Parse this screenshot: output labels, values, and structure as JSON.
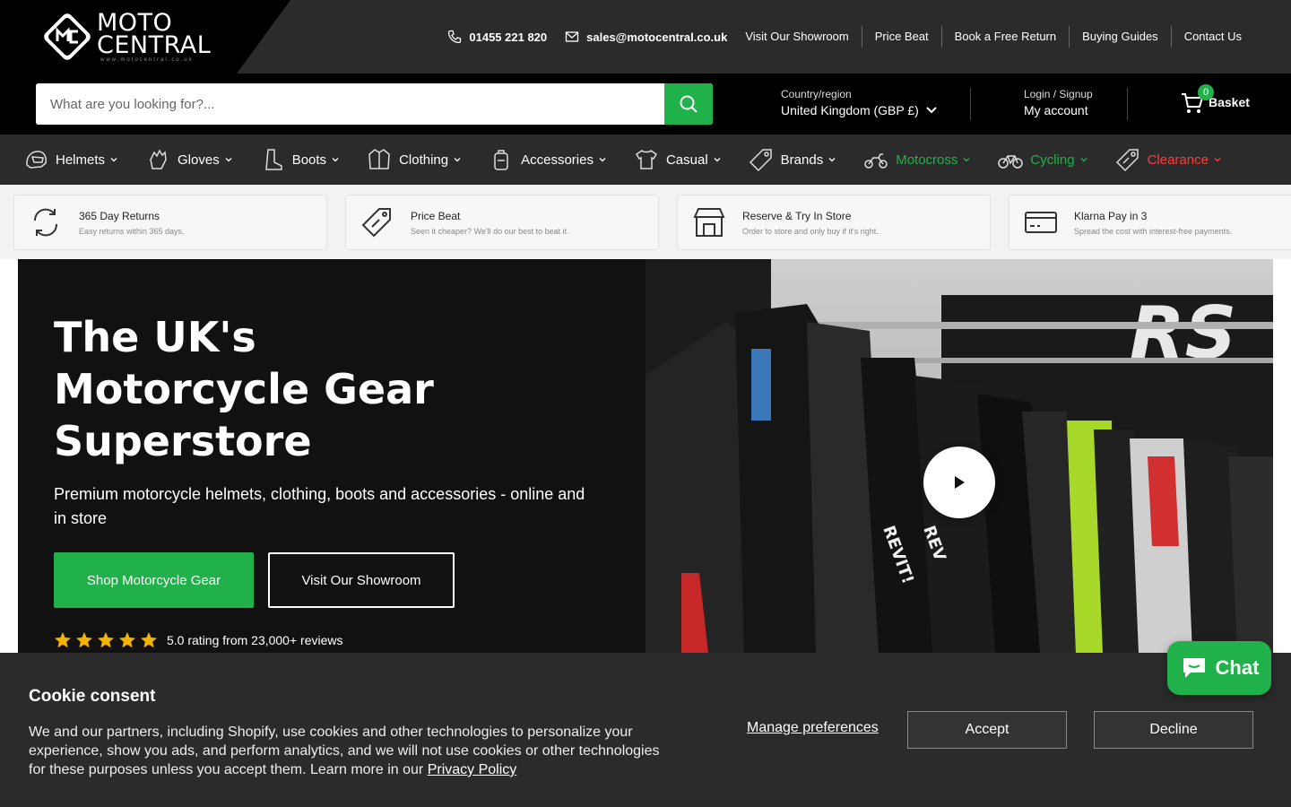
{
  "brand": {
    "name_line1": "MOTO",
    "name_line2": "CENTRAL",
    "url": "www.motocentral.co.uk"
  },
  "topbar": {
    "phone": "01455 221 820",
    "email": "sales@motocentral.co.uk",
    "links": [
      "Visit Our Showroom",
      "Price Beat",
      "Book a Free Return",
      "Buying Guides",
      "Contact Us"
    ]
  },
  "search": {
    "placeholder": "What are you looking for?..."
  },
  "region": {
    "label": "Country/region",
    "value": "United Kingdom (GBP £)"
  },
  "account": {
    "label": "Login / Signup",
    "value": "My account"
  },
  "basket": {
    "label": "Basket",
    "count": "0"
  },
  "nav": {
    "items": [
      {
        "label": "Helmets",
        "icon": "helmet-icon"
      },
      {
        "label": "Gloves",
        "icon": "glove-icon"
      },
      {
        "label": "Boots",
        "icon": "boot-icon"
      },
      {
        "label": "Clothing",
        "icon": "jacket-icon"
      },
      {
        "label": "Accessories",
        "icon": "backpack-icon"
      },
      {
        "label": "Casual",
        "icon": "tshirt-icon"
      },
      {
        "label": "Brands",
        "icon": "tag-icon"
      },
      {
        "label": "Motocross",
        "icon": "dirtbike-icon",
        "color": "#21b14a"
      },
      {
        "label": "Cycling",
        "icon": "bicycle-icon",
        "color": "#21b14a"
      },
      {
        "label": "Clearance",
        "icon": "sale-tag-icon",
        "color": "#ff3b3b"
      }
    ]
  },
  "usps": [
    {
      "title": "365 Day Returns",
      "desc": "Easy returns within 365 days.",
      "icon": "refresh-icon"
    },
    {
      "title": "Price Beat",
      "desc": "Seen it cheaper? We'll do our best to beat it.",
      "icon": "price-tag-icon"
    },
    {
      "title": "Reserve & Try In Store",
      "desc": "Order to store and only buy if it's right.",
      "icon": "store-icon"
    },
    {
      "title": "Klarna Pay in 3",
      "desc": "Spread the cost with interest-free payments.",
      "icon": "card-icon"
    }
  ],
  "hero": {
    "title_line1": "The UK's",
    "title_line2": "Motorcycle Gear",
    "title_line3": "Superstore",
    "subtitle": "Premium motorcycle helmets, clothing, boots and accessories - online and in store",
    "primary_button": "Shop Motorcycle Gear",
    "secondary_button": "Visit Our Showroom",
    "rating_text": "5.0 rating from 23,000+ reviews",
    "stars": 5
  },
  "cookie": {
    "title": "Cookie consent",
    "text": "We and our partners, including Shopify, use cookies and other technologies to personalize your experience, show you ads, and perform analytics, and we will not use cookies or other technologies for these purposes unless you accept them. Learn more in our ",
    "link": "Privacy Policy",
    "manage": "Manage preferences",
    "accept": "Accept",
    "decline": "Decline"
  },
  "chat": {
    "label": "Chat"
  },
  "colors": {
    "accent": "#21b14a",
    "clearance": "#ff3b3b",
    "dark": "#2b2b2b",
    "black": "#000000"
  }
}
